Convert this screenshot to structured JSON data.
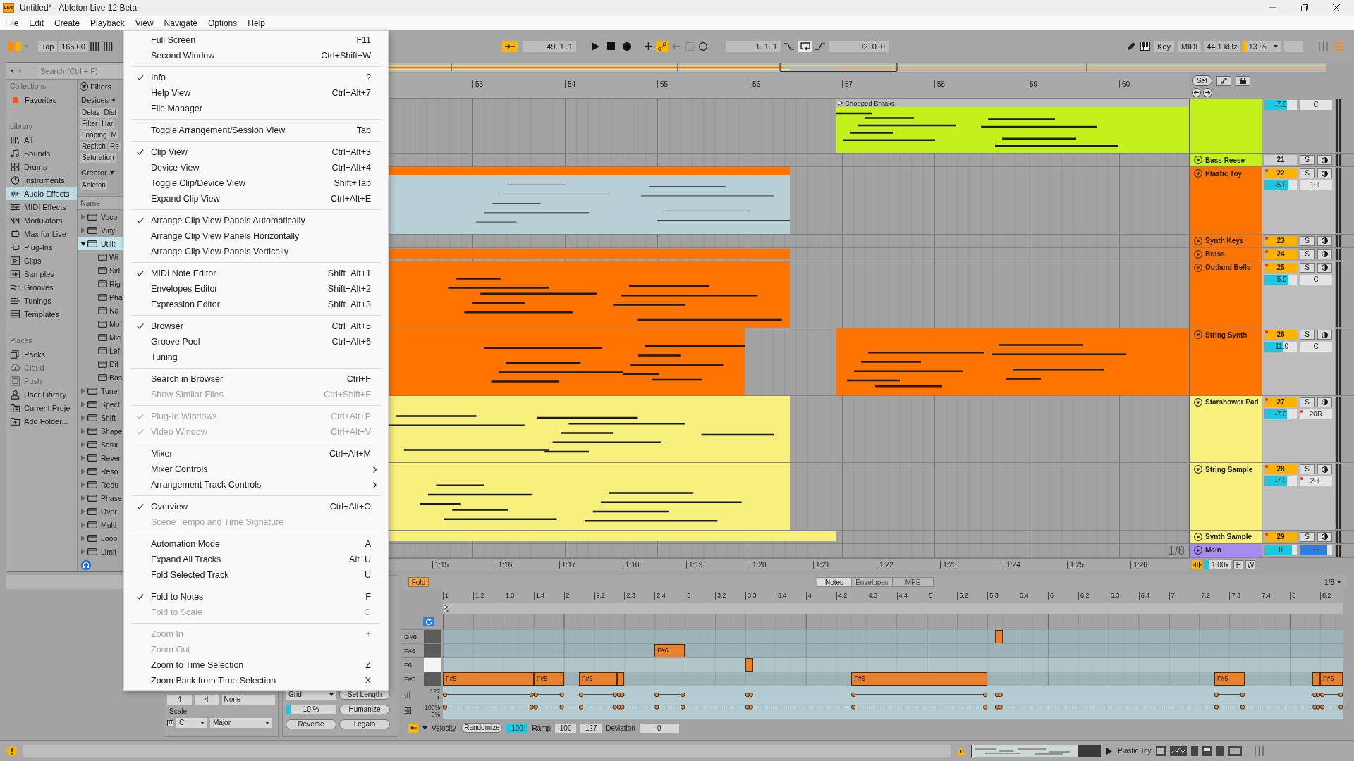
{
  "window": {
    "icon_label": "Live",
    "title": "Untitled* - Ableton Live 12 Beta"
  },
  "menu_bar": [
    "File",
    "Edit",
    "Create",
    "Playback",
    "View",
    "Navigate",
    "Options",
    "Help"
  ],
  "view_menu": [
    [
      {
        "label": "Full Screen",
        "shortcut": "F11",
        "checked": false,
        "disabled": false,
        "submenu": false
      },
      {
        "label": "Second Window",
        "shortcut": "Ctrl+Shift+W",
        "checked": false,
        "disabled": false,
        "submenu": false
      }
    ],
    [
      {
        "label": "Info",
        "shortcut": "?",
        "checked": true,
        "disabled": false,
        "submenu": false
      },
      {
        "label": "Help View",
        "shortcut": "Ctrl+Alt+7",
        "checked": false,
        "disabled": false,
        "submenu": false
      },
      {
        "label": "File Manager",
        "checked": false,
        "disabled": false,
        "submenu": false
      }
    ],
    [
      {
        "label": "Toggle Arrangement/Session View",
        "shortcut": "Tab",
        "checked": false,
        "disabled": false,
        "submenu": false
      }
    ],
    [
      {
        "label": "Clip View",
        "shortcut": "Ctrl+Alt+3",
        "checked": true,
        "disabled": false,
        "submenu": false
      },
      {
        "label": "Device View",
        "shortcut": "Ctrl+Alt+4",
        "checked": false,
        "disabled": false,
        "submenu": false
      },
      {
        "label": "Toggle Clip/Device View",
        "shortcut": "Shift+Tab",
        "checked": false,
        "disabled": false,
        "submenu": false
      },
      {
        "label": "Expand Clip View",
        "shortcut": "Ctrl+Alt+E",
        "checked": false,
        "disabled": false,
        "submenu": false
      }
    ],
    [
      {
        "label": "Arrange Clip View Panels Automatically",
        "checked": true,
        "disabled": false,
        "submenu": false
      },
      {
        "label": "Arrange Clip View Panels Horizontally",
        "checked": false,
        "disabled": false,
        "submenu": false
      },
      {
        "label": "Arrange Clip View Panels Vertically",
        "checked": false,
        "disabled": false,
        "submenu": false
      }
    ],
    [
      {
        "label": "MIDI Note Editor",
        "shortcut": "Shift+Alt+1",
        "checked": true,
        "disabled": false,
        "submenu": false
      },
      {
        "label": "Envelopes Editor",
        "shortcut": "Shift+Alt+2",
        "checked": false,
        "disabled": false,
        "submenu": false
      },
      {
        "label": "Expression Editor",
        "shortcut": "Shift+Alt+3",
        "checked": false,
        "disabled": false,
        "submenu": false
      }
    ],
    [
      {
        "label": "Browser",
        "shortcut": "Ctrl+Alt+5",
        "checked": true,
        "disabled": false,
        "submenu": false
      },
      {
        "label": "Groove Pool",
        "shortcut": "Ctrl+Alt+6",
        "checked": false,
        "disabled": false,
        "submenu": false
      },
      {
        "label": "Tuning",
        "checked": false,
        "disabled": false,
        "submenu": false
      }
    ],
    [
      {
        "label": "Search in Browser",
        "shortcut": "Ctrl+F",
        "checked": false,
        "disabled": false,
        "submenu": false
      },
      {
        "label": "Show Similar Files",
        "shortcut": "Ctrl+Shift+F",
        "checked": false,
        "disabled": true,
        "submenu": false
      }
    ],
    [
      {
        "label": "Plug-In Windows",
        "shortcut": "Ctrl+Alt+P",
        "checked": true,
        "disabled": true,
        "submenu": false
      },
      {
        "label": "Video Window",
        "shortcut": "Ctrl+Alt+V",
        "checked": true,
        "disabled": true,
        "submenu": false
      }
    ],
    [
      {
        "label": "Mixer",
        "shortcut": "Ctrl+Alt+M",
        "checked": false,
        "disabled": false,
        "submenu": false
      },
      {
        "label": "Mixer Controls",
        "checked": false,
        "disabled": false,
        "submenu": true
      },
      {
        "label": "Arrangement Track Controls",
        "checked": false,
        "disabled": false,
        "submenu": true
      }
    ],
    [
      {
        "label": "Overview",
        "shortcut": "Ctrl+Alt+O",
        "checked": true,
        "disabled": false,
        "submenu": false
      },
      {
        "label": "Scene Tempo and Time Signature",
        "checked": false,
        "disabled": true,
        "submenu": false
      }
    ],
    [
      {
        "label": "Automation Mode",
        "shortcut": "A",
        "checked": false,
        "disabled": false,
        "submenu": false
      },
      {
        "label": "Expand All Tracks",
        "shortcut": "Alt+U",
        "checked": false,
        "disabled": false,
        "submenu": false
      },
      {
        "label": "Fold Selected Track",
        "shortcut": "U",
        "checked": false,
        "disabled": false,
        "submenu": false
      }
    ],
    [
      {
        "label": "Fold to Notes",
        "shortcut": "F",
        "checked": true,
        "disabled": false,
        "submenu": false
      },
      {
        "label": "Fold to Scale",
        "shortcut": "G",
        "checked": false,
        "disabled": true,
        "submenu": false
      }
    ],
    [
      {
        "label": "Zoom In",
        "shortcut": "+",
        "checked": false,
        "disabled": true,
        "submenu": false
      },
      {
        "label": "Zoom Out",
        "shortcut": "-",
        "checked": false,
        "disabled": true,
        "submenu": false
      },
      {
        "label": "Zoom to Time Selection",
        "shortcut": "Z",
        "checked": false,
        "disabled": false,
        "submenu": false
      },
      {
        "label": "Zoom Back from Time Selection",
        "shortcut": "X",
        "checked": false,
        "disabled": false,
        "submenu": false
      }
    ]
  ],
  "toolbar": {
    "tap": "Tap",
    "tempo": "165.00",
    "follow": true,
    "position": "49. 1. 1",
    "automation_arm": true,
    "loop_start": "1. 1. 1",
    "loop_length": "92. 0. 0",
    "key": "Key",
    "midi": "MIDI",
    "sample_rate": "44.1 kHz",
    "cpu": "13 %"
  },
  "browser": {
    "search": {
      "placeholder": "Search (Ctrl + F)"
    },
    "sidebar": [
      {
        "title": "Collections",
        "items": [
          {
            "label": "Favorites",
            "kind": "tag",
            "color": "#ff5a00",
            "selected": false,
            "disabled": false
          }
        ]
      },
      {
        "title": "Library",
        "items": [
          {
            "label": "All",
            "kind": "all",
            "selected": false,
            "disabled": false
          },
          {
            "label": "Sounds",
            "kind": "sounds",
            "selected": false,
            "disabled": false
          },
          {
            "label": "Drums",
            "kind": "drums",
            "selected": false,
            "disabled": false
          },
          {
            "label": "Instruments",
            "kind": "instruments",
            "selected": false,
            "disabled": false
          },
          {
            "label": "Audio Effects",
            "kind": "effects",
            "selected": true,
            "disabled": false
          },
          {
            "label": "MIDI Effects",
            "kind": "midi",
            "selected": false,
            "disabled": false
          },
          {
            "label": "Modulators",
            "kind": "modulators",
            "selected": false,
            "disabled": false
          },
          {
            "label": "Max for Live",
            "kind": "max",
            "selected": false,
            "disabled": false
          },
          {
            "label": "Plug-Ins",
            "kind": "plugins",
            "selected": false,
            "disabled": false
          },
          {
            "label": "Clips",
            "kind": "clips",
            "selected": false,
            "disabled": false
          },
          {
            "label": "Samples",
            "kind": "samples",
            "selected": false,
            "disabled": false
          },
          {
            "label": "Grooves",
            "kind": "grooves",
            "selected": false,
            "disabled": false
          },
          {
            "label": "Tunings",
            "kind": "tunings",
            "selected": false,
            "disabled": false
          },
          {
            "label": "Templates",
            "kind": "templates",
            "selected": false,
            "disabled": false
          }
        ]
      },
      {
        "title": "Places",
        "items": [
          {
            "label": "Packs",
            "kind": "packs",
            "selected": false,
            "disabled": false
          },
          {
            "label": "Cloud",
            "kind": "cloud",
            "selected": false,
            "disabled": true
          },
          {
            "label": "Push",
            "kind": "push",
            "selected": false,
            "disabled": true
          },
          {
            "label": "User Library",
            "kind": "user",
            "selected": false,
            "disabled": false
          },
          {
            "label": "Current Proje",
            "kind": "project",
            "selected": false,
            "disabled": false
          },
          {
            "label": "Add Folder...",
            "kind": "folder",
            "selected": false,
            "disabled": false
          }
        ]
      }
    ],
    "filters": {
      "title": "Filters",
      "groups": [
        {
          "title": "Devices",
          "tags": [
            "Delay",
            "Dist",
            "Filter",
            "Har",
            "Looping",
            "M",
            "Repitch",
            "Re",
            "Saturation"
          ]
        },
        {
          "title": "Creator",
          "tags": [
            "Ableton"
          ]
        }
      ]
    },
    "list": {
      "column": "Name",
      "items": [
        {
          "label": "Voco",
          "expanded": false,
          "selected": false
        },
        {
          "label": "Vinyl",
          "expanded": false,
          "selected": false
        },
        {
          "label": "Utilit",
          "expanded": true,
          "selected": true,
          "children": [
            {
              "label": "Wi",
              "selected": false
            },
            {
              "label": "Sid",
              "selected": false
            },
            {
              "label": "Rig",
              "selected": false
            },
            {
              "label": "Pha",
              "selected": false
            },
            {
              "label": "Na",
              "selected": false
            },
            {
              "label": "Mo",
              "selected": false
            },
            {
              "label": "Mic",
              "selected": false
            },
            {
              "label": "Lef",
              "selected": false
            },
            {
              "label": "Dif",
              "selected": false
            },
            {
              "label": "Bas",
              "selected": false
            }
          ]
        },
        {
          "label": "Tuner",
          "expanded": false,
          "selected": false
        },
        {
          "label": "Spect",
          "expanded": false,
          "selected": false
        },
        {
          "label": "Shift",
          "expanded": false,
          "selected": false
        },
        {
          "label": "Shape",
          "expanded": false,
          "selected": false
        },
        {
          "label": "Satur",
          "expanded": false,
          "selected": false
        },
        {
          "label": "Rever",
          "expanded": false,
          "selected": false
        },
        {
          "label": "Reso",
          "expanded": false,
          "selected": false
        },
        {
          "label": "Redu",
          "expanded": false,
          "selected": false
        },
        {
          "label": "Phase",
          "expanded": false,
          "selected": false
        },
        {
          "label": "Over",
          "expanded": false,
          "selected": false
        },
        {
          "label": "Multi",
          "expanded": false,
          "selected": false
        },
        {
          "label": "Loop",
          "expanded": false,
          "selected": false
        },
        {
          "label": "Limit",
          "expanded": false,
          "selected": false
        }
      ]
    }
  },
  "arrangement": {
    "bars": [
      "53",
      "54",
      "55",
      "56",
      "57",
      "58",
      "59",
      "60"
    ],
    "set": "Set",
    "tracks": [
      {
        "color": "#c4f01c",
        "expanded": true,
        "volume": {
          "value": "-7.0",
          "level": 0.7
        },
        "pan": {
          "value": "C",
          "automated": false
        },
        "clips": [
          {
            "name": "Chopped Breaks",
            "selected": false
          }
        ]
      },
      {
        "name": "Bass Reese",
        "color": "#c4f01c",
        "expanded": false,
        "number": {
          "value": "21",
          "active": false,
          "automated": false
        },
        "solo": "S"
      },
      {
        "name": "Plastic Toy",
        "color": "#ff7400",
        "expanded": true,
        "number": {
          "value": "22",
          "active": true,
          "automated": true
        },
        "solo": "S",
        "volume": {
          "value": "-5.0",
          "level": 0.74
        },
        "pan": {
          "value": "10L",
          "automated": false
        },
        "clips": [
          {
            "selected": true
          }
        ]
      },
      {
        "name": "Synth Keys",
        "color": "#ff7400",
        "expanded": false,
        "number": {
          "value": "23",
          "active": true,
          "automated": true
        },
        "solo": "S"
      },
      {
        "name": "Brass",
        "color": "#ff7400",
        "expanded": false,
        "number": {
          "value": "24",
          "active": true,
          "automated": true
        },
        "solo": "S",
        "clips": [
          {
            "selected": false
          }
        ]
      },
      {
        "name": "Outland Bells",
        "color": "#ff7400",
        "expanded": true,
        "number": {
          "value": "25",
          "active": true,
          "automated": true
        },
        "solo": "S",
        "volume": {
          "value": "-5.0",
          "level": 0.74
        },
        "pan": {
          "value": "C",
          "automated": false
        },
        "clips": [
          {
            "selected": false
          }
        ]
      },
      {
        "name": "String Synth",
        "color": "#ff7400",
        "expanded": true,
        "number": {
          "value": "26",
          "active": true,
          "automated": true
        },
        "solo": "S",
        "volume": {
          "value": "-11.0",
          "level": 0.57
        },
        "pan": {
          "value": "C",
          "automated": false
        },
        "clips": [
          {
            "selected": false
          },
          {
            "selected": false
          }
        ]
      },
      {
        "name": "Starshower Pad",
        "color": "#f8f07c",
        "expanded": true,
        "number": {
          "value": "27",
          "active": true,
          "automated": true
        },
        "solo": "S",
        "volume": {
          "value": "-7.0",
          "level": 0.7
        },
        "pan": {
          "value": "20R",
          "automated": true
        },
        "clips": [
          {
            "selected": false
          }
        ]
      },
      {
        "name": "String Sample",
        "color": "#f8f07c",
        "expanded": true,
        "number": {
          "value": "28",
          "active": true,
          "automated": true
        },
        "solo": "S",
        "volume": {
          "value": "-7.0",
          "level": 0.7
        },
        "pan": {
          "value": "20L",
          "automated": true
        },
        "clips": [
          {
            "selected": false
          }
        ]
      },
      {
        "name": "Synth Sample",
        "color": "#f8f07c",
        "expanded": false,
        "number": {
          "value": "29",
          "active": true,
          "automated": true
        },
        "solo": "S",
        "clips": [
          {
            "selected": false
          }
        ]
      }
    ],
    "main": {
      "name": "Main",
      "color": "#a58cf2",
      "expanded": false,
      "volume": {
        "value": "0",
        "level": 0.85
      },
      "cue": {
        "value": "0",
        "level": 0.85
      }
    },
    "grid": "1/8",
    "times": [
      "1:15",
      "1:16",
      "1:17",
      "1:18",
      "1:19",
      "1:20",
      "1:21",
      "1:22",
      "1:23",
      "1:24",
      "1:25",
      "1:26"
    ],
    "zoom": "1.00x",
    "h": "H",
    "w": "W"
  },
  "clip_view": {
    "signature": {
      "numerator": "4",
      "denominator": "4",
      "groove": "None"
    },
    "scale": {
      "title": "Scale",
      "root": "C",
      "mode": "Major"
    },
    "note_tools": {
      "grid": "Grid",
      "set_length": "Set Length",
      "amount": {
        "value": "10 %",
        "level": 0.1
      },
      "humanize": "Humanize",
      "reverse": "Reverse",
      "legato": "Legato"
    },
    "editor": {
      "fold": {
        "label": "Fold",
        "on": true
      },
      "tabs": [
        {
          "label": "Notes",
          "selected": true
        },
        {
          "label": "Envelopes",
          "selected": false
        },
        {
          "label": "MPE",
          "selected": false
        }
      ],
      "grid": "1/8",
      "ruler": [
        "1",
        "1.2",
        "1.3",
        "1.4",
        "2",
        "2.2",
        "2.3",
        "2.4",
        "3",
        "3.2",
        "3.3",
        "3.4",
        "4",
        "4.2",
        "4.3",
        "4.4",
        "5",
        "5.2",
        "5.3",
        "5.4",
        "6",
        "6.2",
        "6.3",
        "6.4",
        "7",
        "7.2",
        "7.3",
        "7.4",
        "8",
        "8.2"
      ],
      "rows": [
        {
          "key": "G#6",
          "black": true,
          "notes": [
            {
              "selected": false
            }
          ]
        },
        {
          "key": "F#6",
          "black": true,
          "notes": [
            {
              "label": "F#6",
              "selected": false
            }
          ]
        },
        {
          "key": "F6",
          "black": false,
          "notes": [
            {
              "selected": false
            }
          ]
        },
        {
          "key": "F#5",
          "black": true,
          "notes": [
            {
              "label": "F#5",
              "selected": false
            },
            {
              "label": "F#5",
              "selected": false
            },
            {
              "label": "F#5",
              "selected": false
            },
            {
              "selected": false
            },
            {
              "label": "F#5",
              "selected": false
            },
            {
              "label": "F#5",
              "selected": false
            },
            {
              "selected": false
            },
            {
              "label": "F#5",
              "selected": false
            }
          ]
        }
      ],
      "velocity": {
        "max": "127",
        "min": "1"
      },
      "chance": {
        "max": "100%",
        "min": "0%"
      },
      "footer": {
        "velocity": "Velocity",
        "randomize": "Randomize",
        "velocity_value": "100",
        "ramp": "Ramp",
        "ramp_from": "100",
        "ramp_to": "127",
        "deviation": "Deviation",
        "deviation_value": "0"
      }
    }
  },
  "status_bar": {
    "track": "Plastic Toy"
  }
}
